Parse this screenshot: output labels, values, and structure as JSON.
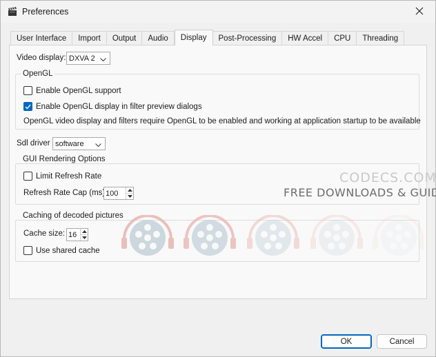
{
  "window": {
    "title": "Preferences"
  },
  "tabs": [
    {
      "label": "User Interface"
    },
    {
      "label": "Import"
    },
    {
      "label": "Output"
    },
    {
      "label": "Audio"
    },
    {
      "label": "Display",
      "active": true
    },
    {
      "label": "Post-Processing"
    },
    {
      "label": "HW Accel"
    },
    {
      "label": "CPU"
    },
    {
      "label": "Threading"
    }
  ],
  "display": {
    "video_display_label": "Video display:",
    "video_display_value": "DXVA 2",
    "opengl": {
      "title": "OpenGL",
      "enable_support_label": "Enable OpenGL support",
      "enable_support_checked": false,
      "enable_preview_label": "Enable OpenGL display in filter preview dialogs",
      "enable_preview_checked": true,
      "note": "OpenGL video display and filters require OpenGL to be enabled and working at application startup to be available"
    },
    "sdl_driver_label": "Sdl driver",
    "sdl_driver_value": "software",
    "gui_rendering": {
      "title": "GUI Rendering Options",
      "limit_refresh_label": "Limit Refresh Rate",
      "limit_refresh_checked": false,
      "refresh_cap_label": "Refresh Rate Cap (ms)",
      "refresh_cap_value": "100"
    },
    "caching": {
      "title": "Caching of decoded pictures",
      "cache_size_label": "Cache size:",
      "cache_size_value": "16",
      "shared_cache_label": "Use shared cache",
      "shared_cache_checked": false
    }
  },
  "watermark": {
    "title": "CODECS.COM",
    "subtitle": "FREE DOWNLOADS & GUIDES"
  },
  "buttons": {
    "ok": "OK",
    "cancel": "Cancel"
  },
  "colors": {
    "accent": "#0067c0",
    "watermark_red": "#e9b9b4",
    "watermark_blue": "#c8d4dc"
  }
}
